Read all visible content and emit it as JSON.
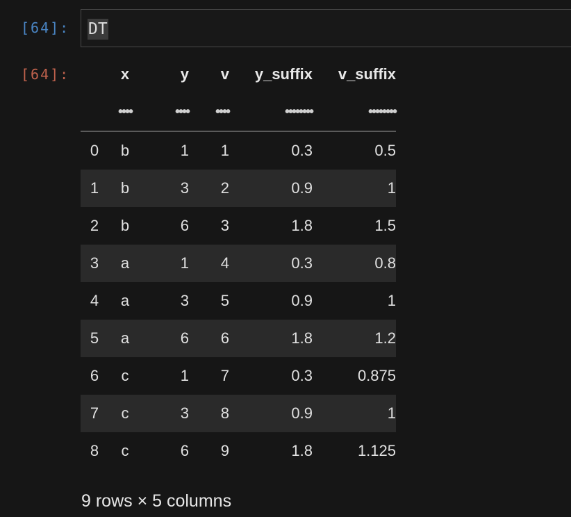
{
  "input_cell": {
    "prompt": "[64]:",
    "code": "DT"
  },
  "output_cell": {
    "prompt": "[64]:",
    "columns": [
      "x",
      "y",
      "v",
      "y_suffix",
      "v_suffix"
    ],
    "column_types": [
      "••••",
      "••••",
      "••••",
      "••••••••",
      "••••••••"
    ],
    "rows": [
      {
        "index": "0",
        "x": "b",
        "y": "1",
        "v": "1",
        "y_suffix": "0.3",
        "v_suffix": "0.5"
      },
      {
        "index": "1",
        "x": "b",
        "y": "3",
        "v": "2",
        "y_suffix": "0.9",
        "v_suffix": "1"
      },
      {
        "index": "2",
        "x": "b",
        "y": "6",
        "v": "3",
        "y_suffix": "1.8",
        "v_suffix": "1.5"
      },
      {
        "index": "3",
        "x": "a",
        "y": "1",
        "v": "4",
        "y_suffix": "0.3",
        "v_suffix": "0.8"
      },
      {
        "index": "4",
        "x": "a",
        "y": "3",
        "v": "5",
        "y_suffix": "0.9",
        "v_suffix": "1"
      },
      {
        "index": "5",
        "x": "a",
        "y": "6",
        "v": "6",
        "y_suffix": "1.8",
        "v_suffix": "1.2"
      },
      {
        "index": "6",
        "x": "c",
        "y": "1",
        "v": "7",
        "y_suffix": "0.3",
        "v_suffix": "0.875"
      },
      {
        "index": "7",
        "x": "c",
        "y": "3",
        "v": "8",
        "y_suffix": "0.9",
        "v_suffix": "1"
      },
      {
        "index": "8",
        "x": "c",
        "y": "6",
        "v": "9",
        "y_suffix": "1.8",
        "v_suffix": "1.125"
      }
    ],
    "shape_caption": "9 rows × 5 columns"
  },
  "colors": {
    "background": "#161616",
    "input_prompt": "#4a86c5",
    "output_prompt": "#c0624d",
    "striped_row": "#2a2a2a"
  }
}
